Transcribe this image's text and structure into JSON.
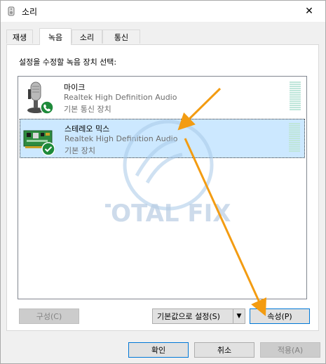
{
  "window": {
    "title": "소리",
    "close_label": "✕"
  },
  "tabs": [
    {
      "label": "재생"
    },
    {
      "label": "녹음",
      "active": true
    },
    {
      "label": "소리"
    },
    {
      "label": "통신"
    }
  ],
  "panel": {
    "instruction": "설정을 수정할 녹음 장치 선택:",
    "devices": [
      {
        "name": "마이크",
        "description": "Realtek High Definition Audio",
        "status": "기본 통신 장치",
        "icon": "microphone-icon",
        "badge": "phone-badge-icon",
        "selected": false
      },
      {
        "name": "스테레오 믹스",
        "description": "Realtek High Definition Audio",
        "status": "기본 장치",
        "icon": "sound-card-icon",
        "badge": "check-badge-icon",
        "selected": true
      }
    ],
    "configure_button": "구성(C)",
    "set_default_button": "기본값으로 설정(S)",
    "properties_button": "속성(P)"
  },
  "footer": {
    "ok": "확인",
    "cancel": "취소",
    "apply": "적용(A)"
  },
  "watermark": {
    "text": "TOTAL FIX!"
  },
  "colors": {
    "selected_bg": "#cce8ff",
    "accent": "#0078d7",
    "annotation_arrow": "#f39c12",
    "meter": "#bfe6da",
    "badge_green": "#1e8a3a"
  }
}
